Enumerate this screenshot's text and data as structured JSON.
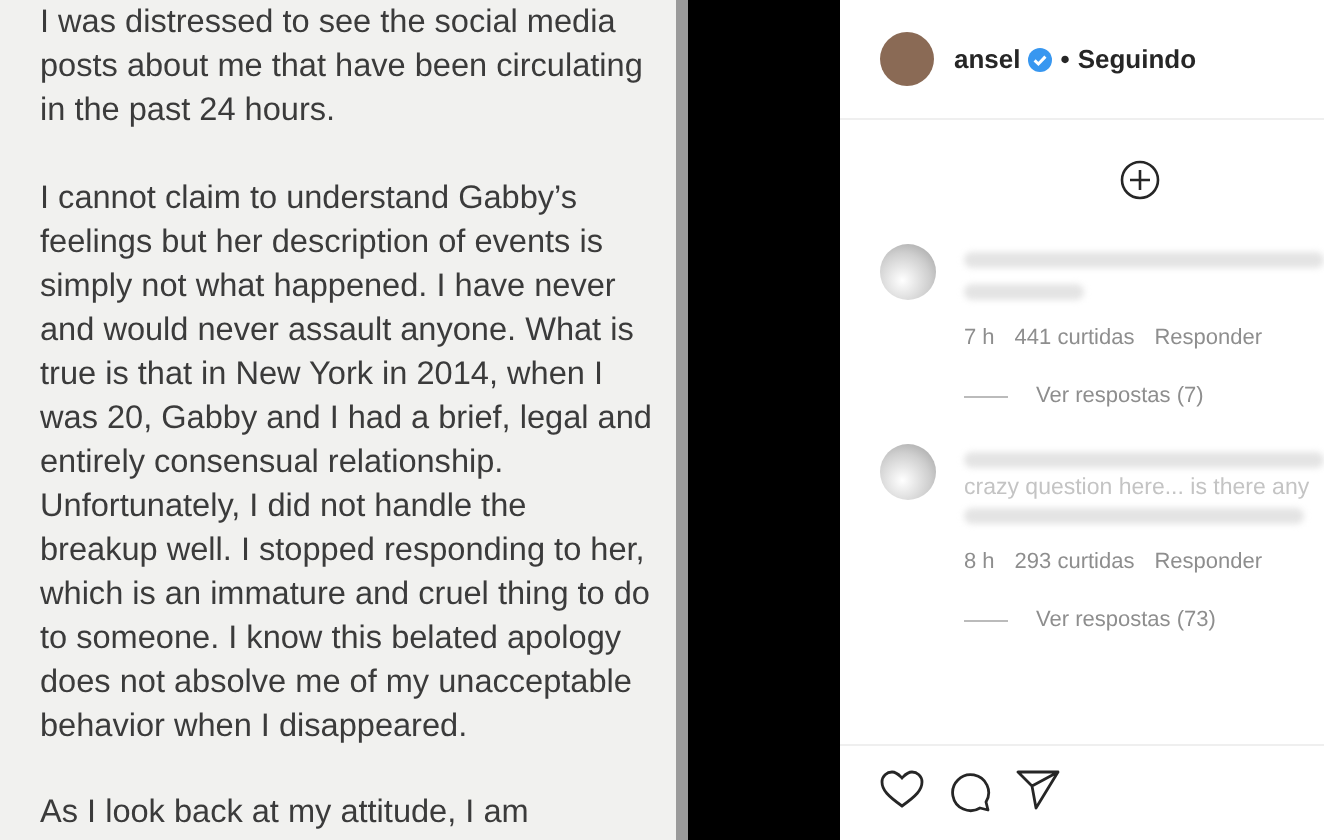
{
  "note": {
    "paragraphs": [
      [
        "I was distressed to see the social media",
        "posts about me that have been circulating",
        "in the past 24 hours."
      ],
      [
        "I cannot claim to understand Gabby’s",
        "feelings but her description of events is",
        "simply not what happened. I have never",
        "and would never assault anyone. What is",
        "true is that in New York in 2014, when I",
        "was 20, Gabby and I had a brief, legal and",
        "entirely consensual relationship.",
        "Unfortunately, I did not handle the",
        "breakup well. I stopped responding to her,",
        "which is an immature and cruel thing to do",
        "to someone. I know this belated apology",
        "does not absolve me of my unacceptable",
        "behavior when I disappeared."
      ],
      [
        "As I look back at my attitude, I am"
      ]
    ]
  },
  "post": {
    "username": "ansel",
    "verified": true,
    "separator": "•",
    "follow_status": "Seguindo",
    "comments": [
      {
        "time": "7 h",
        "likes": "441 curtidas",
        "reply": "Responder",
        "view_replies": "Ver respostas (7)"
      },
      {
        "text": "crazy question here... is there any",
        "time": "8 h",
        "likes": "293 curtidas",
        "reply": "Responder",
        "view_replies": "Ver respostas (73)"
      }
    ]
  }
}
